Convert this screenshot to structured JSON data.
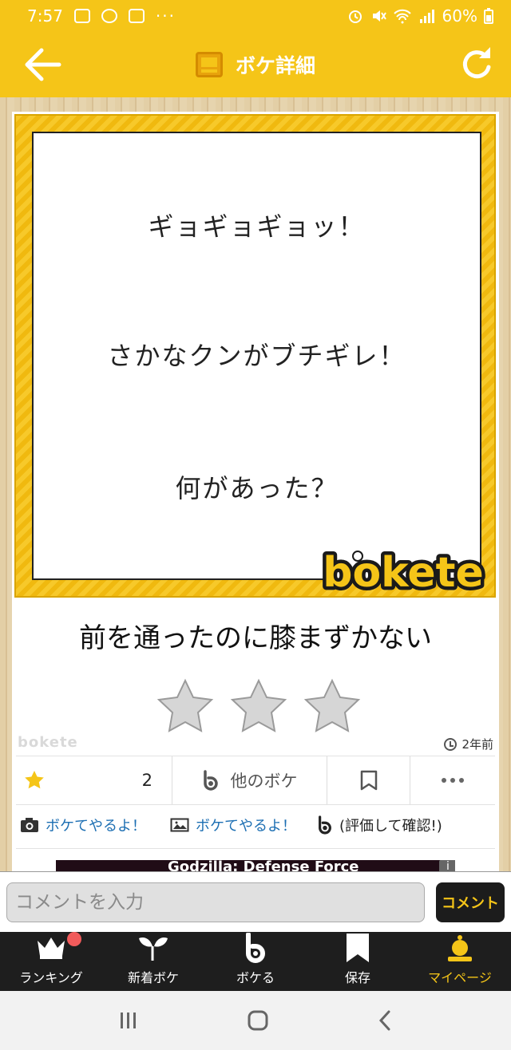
{
  "status": {
    "time": "7:57",
    "more": "···",
    "battery": "60%"
  },
  "header": {
    "title": "ボケ詳細",
    "back_icon": "arrow-left-icon",
    "reload_icon": "refresh-icon"
  },
  "bokeh_image": {
    "lines": [
      "ギョギョギョッ！",
      "さかなクンがブチギレ！",
      "何があった？"
    ],
    "logo_text": "bokete"
  },
  "caption": "前を通ったのに膝まずかない",
  "rating": {
    "stars_filled": 0,
    "stars_total": 3
  },
  "meta": {
    "watermark": "bokete",
    "posted_ago": "2年前"
  },
  "actions": {
    "like_count": "2",
    "other_boke_label": "他のボケ"
  },
  "links": {
    "photo_boke": "ボケてやるよ！",
    "image_boke": "ボケてやるよ！",
    "evaluate": "(評価して確認!)"
  },
  "ad": {
    "title": "Godzilla: Defense Force",
    "info": "i"
  },
  "comment": {
    "placeholder": "コメントを入力",
    "send_label": "コメント"
  },
  "tabs": [
    {
      "label": "ランキング",
      "icon": "crown-icon"
    },
    {
      "label": "新着ボケ",
      "icon": "sprout-icon"
    },
    {
      "label": "ボケる",
      "icon": "bokete-b-icon"
    },
    {
      "label": "保存",
      "icon": "bookmark-icon"
    },
    {
      "label": "マイページ",
      "icon": "user-icon"
    }
  ],
  "colors": {
    "brand": "#f5c518",
    "link": "#1d6fb3",
    "dark": "#1e1e1e",
    "badge": "#f15b5b"
  }
}
